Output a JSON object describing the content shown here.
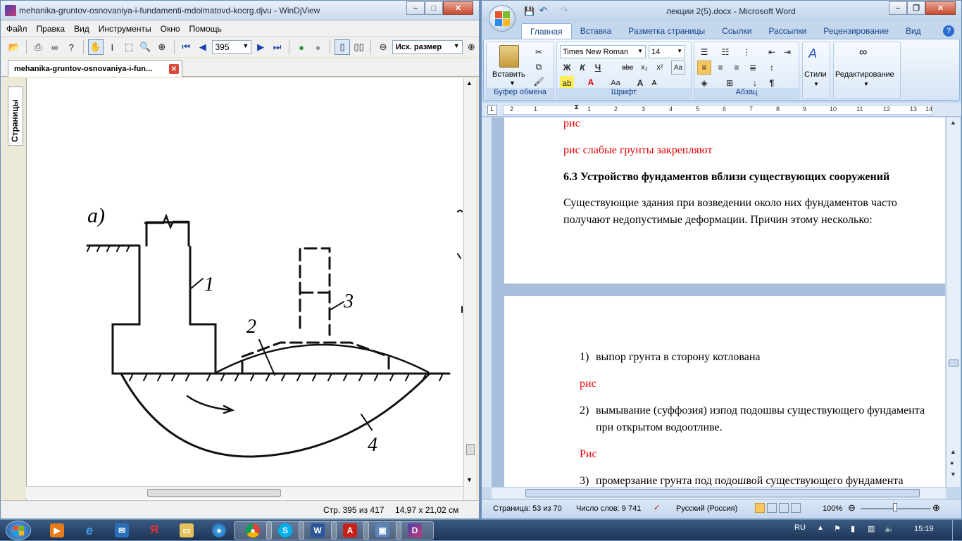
{
  "djview": {
    "title": "mehanika-gruntov-osnovaniya-i-fundamenti-mdolmatovd-kocrg.djvu - WinDjView",
    "menu": [
      "Файл",
      "Правка",
      "Вид",
      "Инструменты",
      "Окно",
      "Помощь"
    ],
    "toolbar": {
      "page_number": "395",
      "zoom": "Исх. размер"
    },
    "tab_label": "mehanika-gruntov-osnovaniya-i-fun...",
    "sidebar_tab": "Страницы",
    "figure_labels": {
      "a": "а)",
      "one": "1",
      "two": "2",
      "three": "3",
      "four": "4"
    },
    "status": {
      "page": "Стр. 395 из 417",
      "size": "14,97 x 21,02 см"
    }
  },
  "word": {
    "title": "лекции 2(5).docx - Microsoft Word",
    "tabs": [
      "Главная",
      "Вставка",
      "Разметка страницы",
      "Ссылки",
      "Рассылки",
      "Рецензирование",
      "Вид"
    ],
    "ribbon": {
      "clipboard": {
        "paste_label": "Вставить",
        "group_label": "Буфер обмена"
      },
      "font": {
        "font_name": "Times New Roman",
        "font_size": "14",
        "group_label": "Шрифт"
      },
      "paragraph": {
        "group_label": "Абзац"
      },
      "styles": {
        "label": "Стили"
      },
      "editing": {
        "label": "Редактирование"
      }
    },
    "ruler_numbers": [
      "2",
      "1",
      "1",
      "2",
      "3",
      "4",
      "5",
      "6",
      "7",
      "8",
      "9",
      "10",
      "11",
      "12",
      "13",
      "14"
    ],
    "doc": {
      "line1": "рис",
      "line2": "рис слабые грунты закрепляют",
      "heading": "6.3 Устройство фундаментов вблизи существующих сооружений",
      "para1a": "Существующие здания при возведении около них фундаментов часто",
      "para1b": "получают недопустимые деформации. Причин этому несколько:",
      "item1_num": "1)",
      "item1": "выпор грунта в сторону котлована",
      "ris1": "рис",
      "item2_num": "2)",
      "item2a": "вымывание (суффозия) изпод подошвы существующего фундамента",
      "item2b": "при открытом водоотливе.",
      "ris2": "Рис",
      "item3_num": "3)",
      "item3": "промерзание грунта под подошвой существующего фундамента"
    },
    "status": {
      "page": "Страница: 53 из 70",
      "words": "Число слов: 9 741",
      "language": "Русский (Россия)",
      "zoom": "100%"
    }
  },
  "taskbar": {
    "lang": "RU",
    "time": "15:19"
  }
}
